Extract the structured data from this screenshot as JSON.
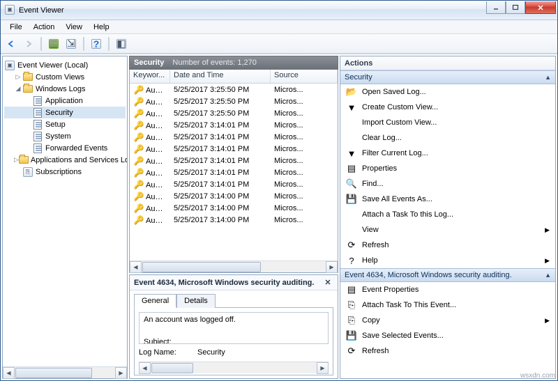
{
  "window": {
    "title": "Event Viewer"
  },
  "menu": {
    "items": [
      "File",
      "Action",
      "View",
      "Help"
    ]
  },
  "tree": {
    "root": "Event Viewer (Local)",
    "nodes": [
      {
        "label": "Custom Views",
        "icon": "folder",
        "twist": "▷",
        "indent": 1
      },
      {
        "label": "Windows Logs",
        "icon": "folder",
        "twist": "◢",
        "indent": 1
      },
      {
        "label": "Application",
        "icon": "log",
        "indent": 2
      },
      {
        "label": "Security",
        "icon": "log",
        "indent": 2,
        "selected": true
      },
      {
        "label": "Setup",
        "icon": "log",
        "indent": 2
      },
      {
        "label": "System",
        "icon": "log",
        "indent": 2
      },
      {
        "label": "Forwarded Events",
        "icon": "log",
        "indent": 2
      },
      {
        "label": "Applications and Services Lo",
        "icon": "folder",
        "twist": "▷",
        "indent": 1
      },
      {
        "label": "Subscriptions",
        "icon": "sub",
        "indent": 1
      }
    ]
  },
  "center": {
    "header_title": "Security",
    "header_count": "Number of events: 1,270",
    "columns": {
      "keywords": "Keywor...",
      "date": "Date and Time",
      "source": "Source"
    },
    "rows": [
      {
        "kw": "Audi...",
        "date": "5/25/2017 3:25:50 PM",
        "src": "Micros..."
      },
      {
        "kw": "Audi...",
        "date": "5/25/2017 3:25:50 PM",
        "src": "Micros..."
      },
      {
        "kw": "Audi...",
        "date": "5/25/2017 3:25:50 PM",
        "src": "Micros..."
      },
      {
        "kw": "Audi...",
        "date": "5/25/2017 3:14:01 PM",
        "src": "Micros..."
      },
      {
        "kw": "Audi...",
        "date": "5/25/2017 3:14:01 PM",
        "src": "Micros..."
      },
      {
        "kw": "Audi...",
        "date": "5/25/2017 3:14:01 PM",
        "src": "Micros..."
      },
      {
        "kw": "Audi...",
        "date": "5/25/2017 3:14:01 PM",
        "src": "Micros..."
      },
      {
        "kw": "Audi...",
        "date": "5/25/2017 3:14:01 PM",
        "src": "Micros..."
      },
      {
        "kw": "Audi...",
        "date": "5/25/2017 3:14:01 PM",
        "src": "Micros..."
      },
      {
        "kw": "Audi...",
        "date": "5/25/2017 3:14:00 PM",
        "src": "Micros..."
      },
      {
        "kw": "Audi...",
        "date": "5/25/2017 3:14:00 PM",
        "src": "Micros..."
      },
      {
        "kw": "Audi...",
        "date": "5/25/2017 3:14:00 PM",
        "src": "Micros..."
      }
    ]
  },
  "detail": {
    "title": "Event 4634, Microsoft Windows security auditing.",
    "tabs": {
      "general": "General",
      "details": "Details"
    },
    "message_l1": "An account was logged off.",
    "message_l2": "Subject:",
    "logname_label": "Log Name:",
    "logname_value": "Security"
  },
  "actions": {
    "header": "Actions",
    "section1_title": "Security",
    "section1": [
      {
        "label": "Open Saved Log...",
        "icon": "folder"
      },
      {
        "label": "Create Custom View...",
        "icon": "filter"
      },
      {
        "label": "Import Custom View...",
        "icon": ""
      },
      {
        "label": "Clear Log...",
        "icon": ""
      },
      {
        "label": "Filter Current Log...",
        "icon": "filter"
      },
      {
        "label": "Properties",
        "icon": "props"
      },
      {
        "label": "Find...",
        "icon": "find"
      },
      {
        "label": "Save All Events As...",
        "icon": "save"
      },
      {
        "label": "Attach a Task To this Log...",
        "icon": ""
      },
      {
        "label": "View",
        "icon": "",
        "arrow": true
      },
      {
        "label": "Refresh",
        "icon": "refresh"
      },
      {
        "label": "Help",
        "icon": "help",
        "arrow": true
      }
    ],
    "section2_title": "Event 4634, Microsoft Windows security auditing.",
    "section2": [
      {
        "label": "Event Properties",
        "icon": "props"
      },
      {
        "label": "Attach Task To This Event...",
        "icon": "task"
      },
      {
        "label": "Copy",
        "icon": "copy",
        "arrow": true
      },
      {
        "label": "Save Selected Events...",
        "icon": "save"
      },
      {
        "label": "Refresh",
        "icon": "refresh"
      }
    ]
  },
  "watermark": "wsxdn.com"
}
